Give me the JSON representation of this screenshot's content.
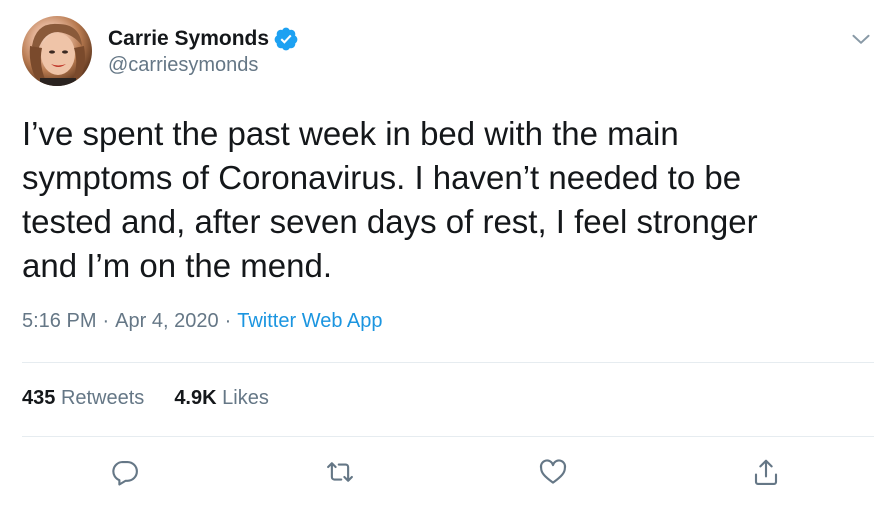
{
  "author": {
    "display_name": "Carrie Symonds",
    "handle": "@carriesymonds",
    "verified": true
  },
  "tweet": {
    "text": "I’ve spent the past week in bed with the main\nsymptoms of Coronavirus. I haven’t needed to be\ntested and, after seven days of rest, I feel stronger\nand I’m on the mend.",
    "time": "5:16 PM",
    "separator": "·",
    "date": "Apr 4, 2020",
    "source": "Twitter Web App"
  },
  "stats": {
    "retweets_count": "435",
    "retweets_label": "Retweets",
    "likes_count": "4.9K",
    "likes_label": "Likes"
  },
  "colors": {
    "text": "#14171a",
    "secondary": "#657786",
    "link": "#1b95e0",
    "verified": "#1da1f2",
    "divider": "#e6ecf0",
    "icon": "#657786"
  },
  "icons": {
    "verified": "verified-badge-icon",
    "more": "chevron-down-icon",
    "reply": "reply-icon",
    "retweet": "retweet-icon",
    "like": "heart-icon",
    "share": "share-icon"
  }
}
